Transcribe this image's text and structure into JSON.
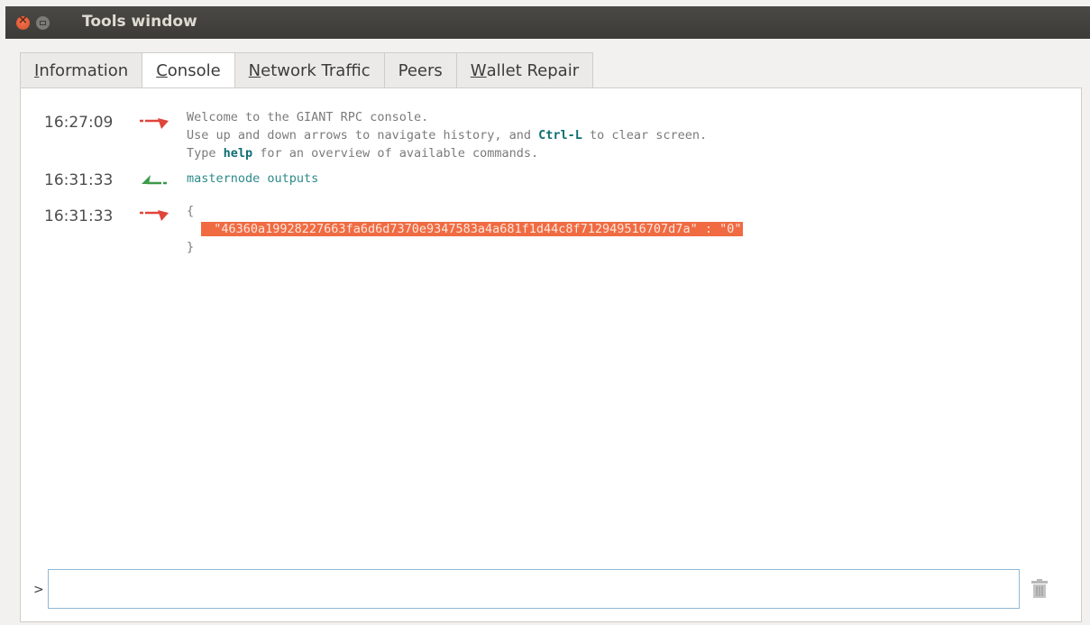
{
  "window": {
    "title": "Tools window"
  },
  "tabs": [
    {
      "label_first": "I",
      "label_rest": "nformation"
    },
    {
      "label_first": "C",
      "label_rest": "onsole"
    },
    {
      "label_first": "N",
      "label_rest": "etwork Traffic"
    },
    {
      "label_first": "",
      "label_rest": "Peers"
    },
    {
      "label_first": "W",
      "label_rest": "allet Repair"
    }
  ],
  "console": {
    "messages": [
      {
        "time": "16:27:09",
        "direction": "reply",
        "line1": "Welcome to the GIANT RPC console.",
        "line2_pre": "Use up and down arrows to navigate history, and ",
        "line2_key": "Ctrl-L",
        "line2_post": " to clear screen.",
        "line3_pre": "Type ",
        "line3_key": "help",
        "line3_post": " for an overview of available commands."
      },
      {
        "time": "16:31:33",
        "direction": "request",
        "text": "masternode outputs"
      },
      {
        "time": "16:31:33",
        "direction": "reply",
        "open": "{",
        "highlight": "\"46360a19928227663fa6d6d7370e9347583a4a681f1d44c8f712949516707d7a\" : \"0\"",
        "close": "}"
      }
    ],
    "prompt": ">",
    "input_value": "",
    "colors": {
      "reply_arrow": "#e0443a",
      "request_arrow": "#3c9a4a",
      "highlight": "#f06b42"
    }
  }
}
